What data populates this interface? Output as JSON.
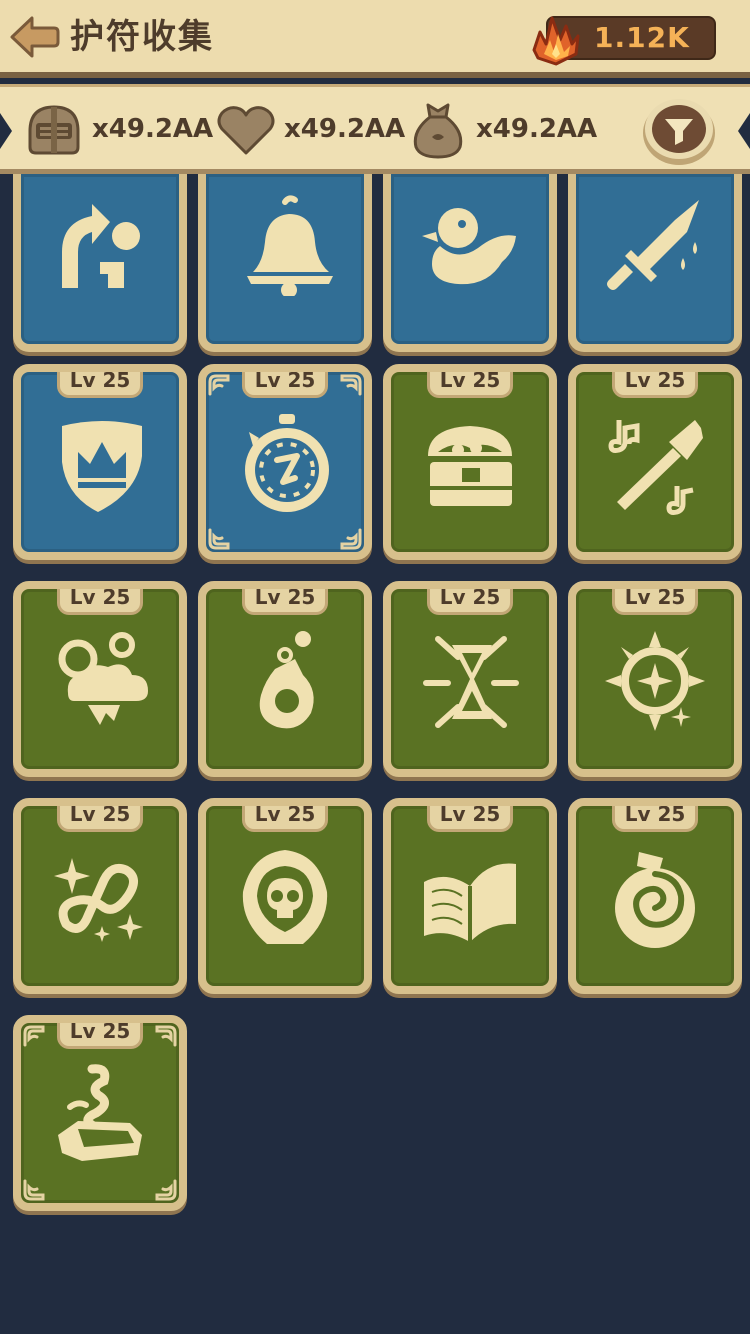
{
  "header": {
    "back_icon": "back-arrow-icon",
    "title": "护符收集",
    "gem_icon": "crystal-icon",
    "gem_value": "1.12K"
  },
  "resources": [
    {
      "icon": "knight-helmet-icon",
      "value": "x49.2AA"
    },
    {
      "icon": "heart-icon",
      "value": "x49.2AA"
    },
    {
      "icon": "money-bag-icon",
      "value": "x49.2AA"
    }
  ],
  "filter_icon": "filter-funnel-icon",
  "colors": {
    "background": "#212c40",
    "parchment": "#eddcae",
    "card_blue": "#316e95",
    "card_green": "#5a7223",
    "icon_cream": "#f0e1b1",
    "gem_text": "#f5b257"
  },
  "cards": [
    {
      "level": "",
      "color": "blue",
      "icon": "curved-arrow-ball-icon"
    },
    {
      "level": "",
      "color": "blue",
      "icon": "bell-icon"
    },
    {
      "level": "",
      "color": "blue",
      "icon": "rubber-duck-icon"
    },
    {
      "level": "",
      "color": "blue",
      "icon": "bleeding-dagger-icon"
    },
    {
      "level": "Lv 25",
      "color": "blue",
      "icon": "crown-shield-icon"
    },
    {
      "level": "Lv 25",
      "color": "blue",
      "icon": "stopwatch-icon"
    },
    {
      "level": "Lv 25",
      "color": "green",
      "icon": "treasure-chest-icon"
    },
    {
      "level": "Lv 25",
      "color": "green",
      "icon": "music-horn-icon"
    },
    {
      "level": "Lv 25",
      "color": "green",
      "icon": "storm-cloud-icon"
    },
    {
      "level": "Lv 25",
      "color": "green",
      "icon": "falling-meteor-icon"
    },
    {
      "level": "Lv 25",
      "color": "green",
      "icon": "shattered-hourglass-icon"
    },
    {
      "level": "Lv 25",
      "color": "green",
      "icon": "sun-star-icon"
    },
    {
      "level": "Lv 25",
      "color": "green",
      "icon": "infinity-sparkle-icon"
    },
    {
      "level": "Lv 25",
      "color": "green",
      "icon": "hooded-skull-icon"
    },
    {
      "level": "Lv 25",
      "color": "green",
      "icon": "open-book-icon"
    },
    {
      "level": "Lv 25",
      "color": "green",
      "icon": "swirl-potion-icon"
    },
    {
      "level": "Lv 25",
      "color": "green",
      "icon": "smoking-stone-icon"
    }
  ]
}
